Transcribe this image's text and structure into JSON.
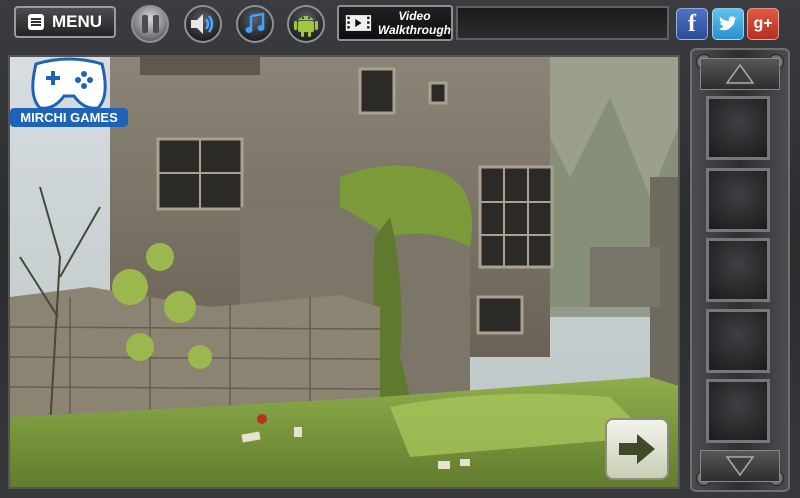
{
  "toolbar": {
    "menu_label": "MENU",
    "video_label_line1": "Video",
    "video_label_line2": "Walkthrough"
  },
  "brand": {
    "logo_text": "MIRCHI GAMES"
  },
  "social": {
    "facebook_glyph": "f",
    "googleplus_glyph": "g+"
  },
  "inventory": {
    "slot_count": 5
  },
  "colors": {
    "accent_blue": "#1f63b8",
    "frame": "#2b2d2f",
    "next_arrow": "#3e4a2a"
  }
}
